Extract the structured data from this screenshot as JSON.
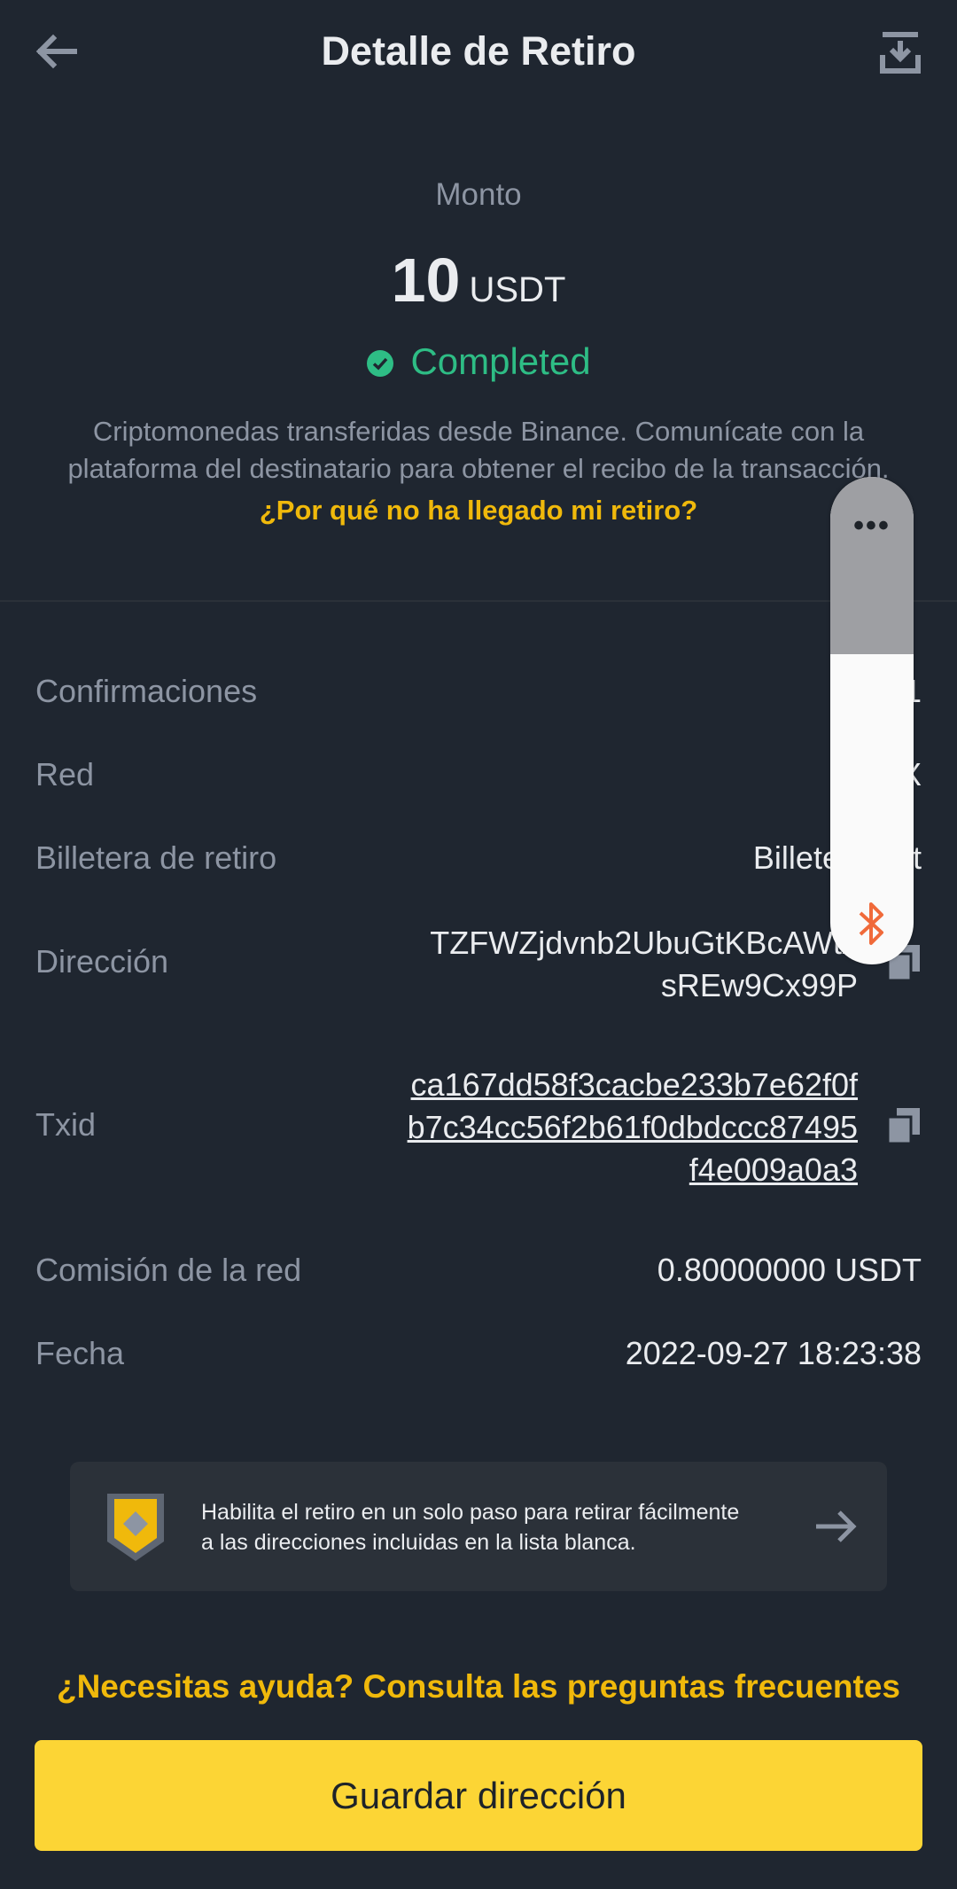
{
  "header": {
    "title": "Detalle de Retiro",
    "back_icon": "back-arrow-icon",
    "export_icon": "download-icon"
  },
  "summary": {
    "amount_label": "Monto",
    "amount": "10",
    "currency": "USDT",
    "status": "Completed",
    "status_color": "#2ebd85",
    "info_line1": "Criptomonedas transferidas desde Binance. Comunícate con la",
    "info_line2": "plataforma del destinatario para obtener el recibo de la transacción.",
    "why_link": "¿Por qué no ha llegado mi retiro?"
  },
  "details": {
    "confirmations_label": "Confirmaciones",
    "confirmations_value": "1",
    "network_label": "Red",
    "network_value": "X",
    "wallet_label": "Billetera de retiro",
    "wallet_value": "Billetera ... t",
    "address_label": "Dirección",
    "address_line1": "TZFWZjdvnb2UbuGtKBcAWtx",
    "address_line2": "sREw9Cx99P",
    "txid_label": "Txid",
    "txid_line1": "ca167dd58f3cacbe233b7e62f0f",
    "txid_line2": "b7c34cc56f2b61f0dbdccc87495",
    "txid_line3": "f4e009a0a3",
    "fee_label": "Comisión de la red",
    "fee_value": "0.80000000 USDT",
    "date_label": "Fecha",
    "date_value": "2022-09-27 18:23:38"
  },
  "promo": {
    "line1": "Habilita el retiro en un solo paso para retirar fácilmente",
    "line2": "a las direcciones incluidas en la lista blanca."
  },
  "help_link": "¿Necesitas ayuda? Consulta las preguntas frecuentes",
  "primary_button": "Guardar dirección",
  "overlay": {
    "menu_dots": "•••",
    "icon": "bluetooth-icon"
  },
  "colors": {
    "background": "#1f2630",
    "accent": "#f0b90b",
    "button": "#fcd535",
    "success": "#2ebd85"
  }
}
